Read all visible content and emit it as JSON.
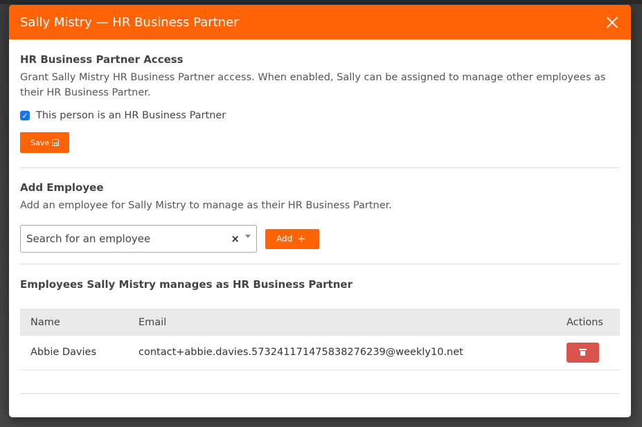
{
  "modal": {
    "title": "Sally Mistry — HR Business Partner",
    "close_icon": "close-icon"
  },
  "access": {
    "title": "HR Business Partner Access",
    "description": "Grant Sally Mistry HR Business Partner access. When enabled, Sally can be assigned to manage other employees as their HR Business Partner.",
    "checkbox_label": "This person is an HR Business Partner",
    "checkbox_checked": true,
    "save_label": "Save",
    "save_icon": "save-icon"
  },
  "add_employee": {
    "title": "Add Employee",
    "description": "Add an employee for Sally Mistry to manage as their HR Business Partner.",
    "search_placeholder": "Search for an employee",
    "clear_label": "×",
    "add_label": "Add",
    "add_icon": "+"
  },
  "managed": {
    "title": "Employees Sally Mistry manages as HR Business Partner",
    "columns": [
      "Name",
      "Email",
      "Actions"
    ],
    "rows": [
      {
        "name": "Abbie Davies",
        "email": "contact+abbie.davies.573241171475838276239@weekly10.net",
        "action_icon": "trash-icon"
      }
    ]
  },
  "colors": {
    "accent": "#ff6306",
    "danger": "#d9534f",
    "checkbox": "#1a73e8"
  }
}
